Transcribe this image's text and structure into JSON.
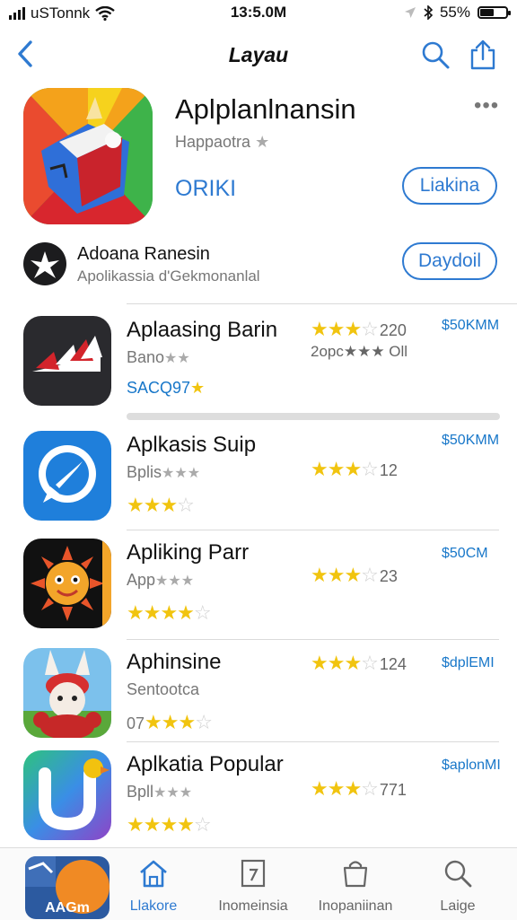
{
  "status_bar": {
    "carrier": "uSTonnk",
    "time": "13:5.0M",
    "battery": "55%",
    "battery_level": 0.55
  },
  "nav": {
    "title": "Layau"
  },
  "hero": {
    "title": "Aplplanlnansin",
    "subtitle": "Happaotra",
    "subtitle_star": "★",
    "price": "ORIKI",
    "button": "Liakina"
  },
  "developer": {
    "name": "Adoana Ranesin",
    "subtitle": "Apolikassia d'Gekmonanlal",
    "button": "Daydoil"
  },
  "apps": [
    {
      "title": "Aplaasing Barin",
      "subtitle": "Bano",
      "subtitle_stars": "★★",
      "meta": "SACQ97",
      "meta_star": "★",
      "stars": "★★★",
      "stars_off": "☆",
      "rating_count": "220",
      "extra": "2opc★★★ Oll",
      "price": "$50KMM",
      "icon": "stripes-app-icon"
    },
    {
      "title": "Aplkasis Suip",
      "subtitle": "Bplis",
      "subtitle_stars": "★★★",
      "meta_stars": "★★★",
      "meta_stars_off": "☆",
      "stars": "★★★",
      "stars_off": "☆",
      "rating_count": "12",
      "price": "$50KMM",
      "icon": "chat-bubble-app-icon"
    },
    {
      "title": "Apliking Parr",
      "subtitle": "App",
      "subtitle_stars": "★★★",
      "meta_stars": "★★★★",
      "meta_stars_off": "☆",
      "stars": "★★★",
      "stars_off": "☆",
      "rating_count": "23",
      "price": "$50CM",
      "icon": "sun-face-app-icon"
    },
    {
      "title": "Aphinsine",
      "subtitle": "Sentootca",
      "meta": "07",
      "meta_stars": "★★★",
      "meta_stars_off": "☆",
      "stars": "★★★",
      "stars_off": "☆",
      "rating_count": "124",
      "price": "$dplEMI",
      "icon": "rabbit-character-app-icon"
    },
    {
      "title": "Aplkatia Popular",
      "subtitle": "Bpll",
      "subtitle_stars": "★★★",
      "meta_stars": "★★★★",
      "meta_stars_off": "☆",
      "stars": "★★★",
      "stars_off": "☆",
      "rating_count": "771",
      "price": "$aplonMI",
      "icon": "colorful-u-app-icon"
    }
  ],
  "tabs": [
    {
      "label": "AAGm",
      "icon": "app-thumbnail"
    },
    {
      "label": "Llakore",
      "icon": "home-icon"
    },
    {
      "label": "Inomeinsia",
      "icon": "note-icon"
    },
    {
      "label": "Inopaniinan",
      "icon": "bag-icon"
    },
    {
      "label": "Laige",
      "icon": "search-icon"
    }
  ],
  "colors": {
    "accent": "#2e7ad1",
    "star": "#f1c40f"
  }
}
